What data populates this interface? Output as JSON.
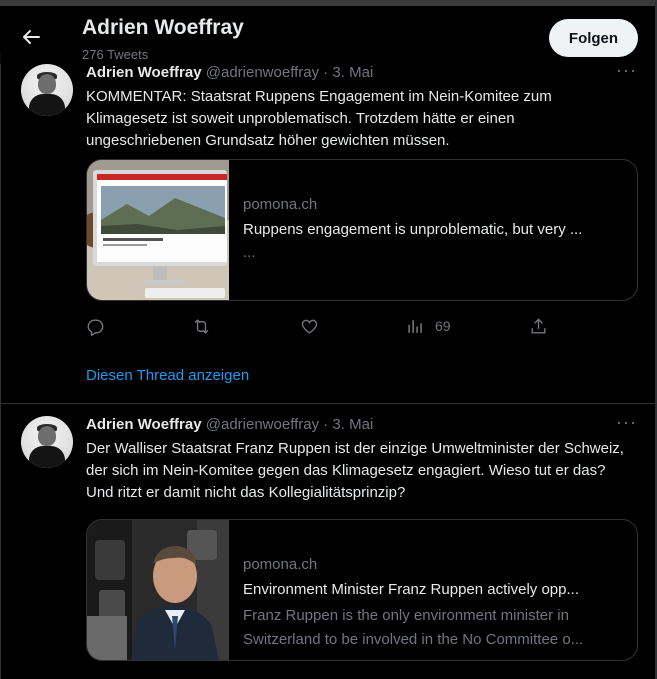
{
  "header": {
    "title": "Adrien Woeffray",
    "tweet_count": "276 Tweets",
    "follow_label": "Folgen"
  },
  "tweets": [
    {
      "author_name": "Adrien Woeffray",
      "author_meta": "@adrienwoeffray · 3. Mai",
      "text": "KOMMENTAR: Staatsrat Ruppens Engagement im Nein-Komitee zum Klimagesetz ist soweit unproblematisch. Trotzdem hätte er einen ungeschriebenen Grundsatz höher gewichten müssen.",
      "card": {
        "domain": "pomona.ch",
        "title": "Ruppens engagement is unproblematic, but very ...",
        "description": "..."
      },
      "views": "69",
      "thread_link": "Diesen Thread anzeigen"
    },
    {
      "author_name": "Adrien Woeffray",
      "author_meta": "@adrienwoeffray · 3. Mai",
      "text": "Der Walliser Staatsrat Franz Ruppen ist der einzige Umweltminister der Schweiz, der sich im Nein-Komitee gegen das Klimagesetz engagiert. Wieso tut er das? Und ritzt er damit nicht das Kollegialitätsprinzip?",
      "card": {
        "domain": "pomona.ch",
        "title": "Environment Minister Franz Ruppen actively opp...",
        "description": "Franz Ruppen is the only environment minister in Switzerland to be involved in the No Committee o..."
      }
    }
  ],
  "icons": {
    "back": "arrow-left-icon",
    "more": "more-horizontal-icon",
    "reply": "reply-icon",
    "retweet": "retweet-icon",
    "like": "heart-icon",
    "views": "views-icon",
    "share": "share-icon"
  },
  "colors": {
    "background": "#000000",
    "text": "#e7e9ea",
    "muted": "#71767b",
    "link": "#1d9bf0",
    "border": "#2f3336",
    "follow_button": "#eff3f4"
  }
}
